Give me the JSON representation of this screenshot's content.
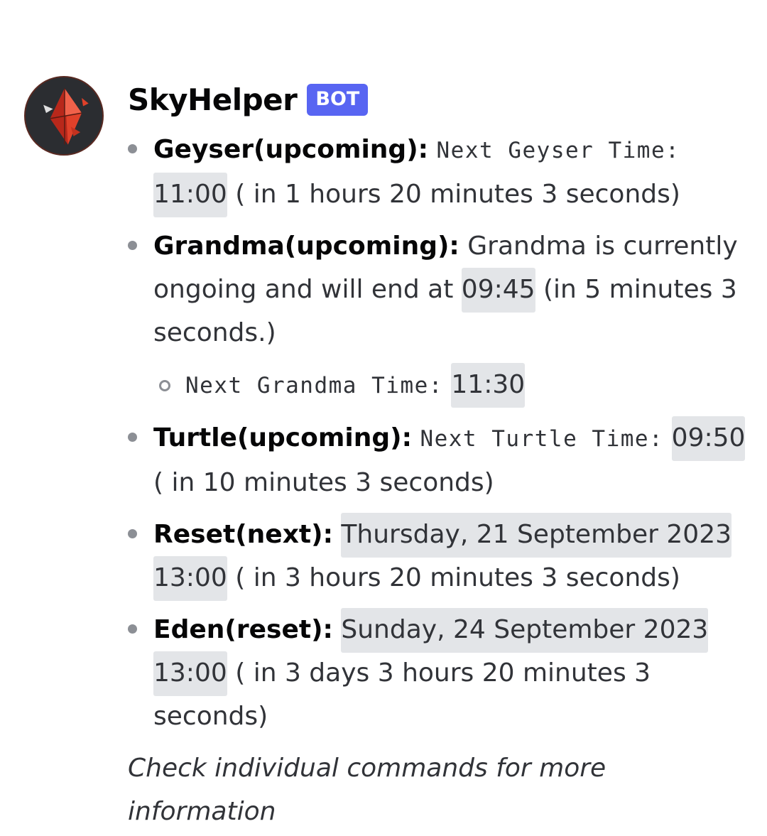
{
  "author": {
    "username": "SkyHelper",
    "badge": "BOT",
    "avatar_icon": "skyhelper-crystal-avatar-icon",
    "avatar_bg": "#2b2d31",
    "badge_color": "#5865f2"
  },
  "events": [
    {
      "label": "Geyser(upcoming):",
      "mono_text": "Next Geyser Time:",
      "time": "11:00",
      "after": "( in 1 hours 20 minutes 3 seconds)"
    },
    {
      "label": "Grandma(upcoming):",
      "text": "Grandma is currently ongoing and will end at",
      "time": "09:45",
      "after": "(in 5 minutes  3 seconds.)",
      "sub": {
        "mono_text": "Next Grandma Time:",
        "time": "11:30"
      }
    },
    {
      "label": "Turtle(upcoming):",
      "mono_text": "Next Turtle Time:",
      "time": "09:50",
      "after": "( in  10 minutes 3 seconds)"
    },
    {
      "label": "Reset(next):",
      "date": "Thursday, 21 September 2023",
      "time": "13:00",
      "after": "( in 3 hours 20 minutes 3 seconds)"
    },
    {
      "label": "Eden(reset):",
      "date": "Sunday, 24 September 2023",
      "time": "13:00",
      "after": "( in 3 days 3 hours 20 minutes 3 seconds)"
    }
  ],
  "footer": "Check individual commands for more information"
}
